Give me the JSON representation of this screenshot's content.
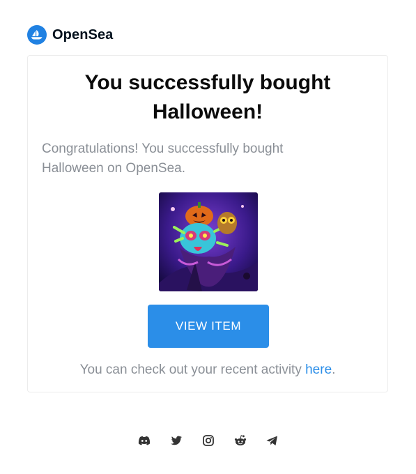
{
  "brand": {
    "name": "OpenSea",
    "color": "#2081e2"
  },
  "card": {
    "headline": "You successfully bought Halloween!",
    "message": "Congratulations! You successfully bought Halloween on OpenSea.",
    "item_image": "halloween-nft-artwork",
    "button_label": "VIEW ITEM",
    "activity_text": "You can check out your recent activity ",
    "activity_link": "here",
    "activity_end": "."
  },
  "colors": {
    "accent": "#2b8ee8",
    "muted_text": "#8a8f96",
    "heading": "#0b0b0b"
  },
  "footer": {
    "socials": [
      "discord-icon",
      "twitter-icon",
      "instagram-icon",
      "reddit-icon",
      "telegram-icon"
    ]
  }
}
